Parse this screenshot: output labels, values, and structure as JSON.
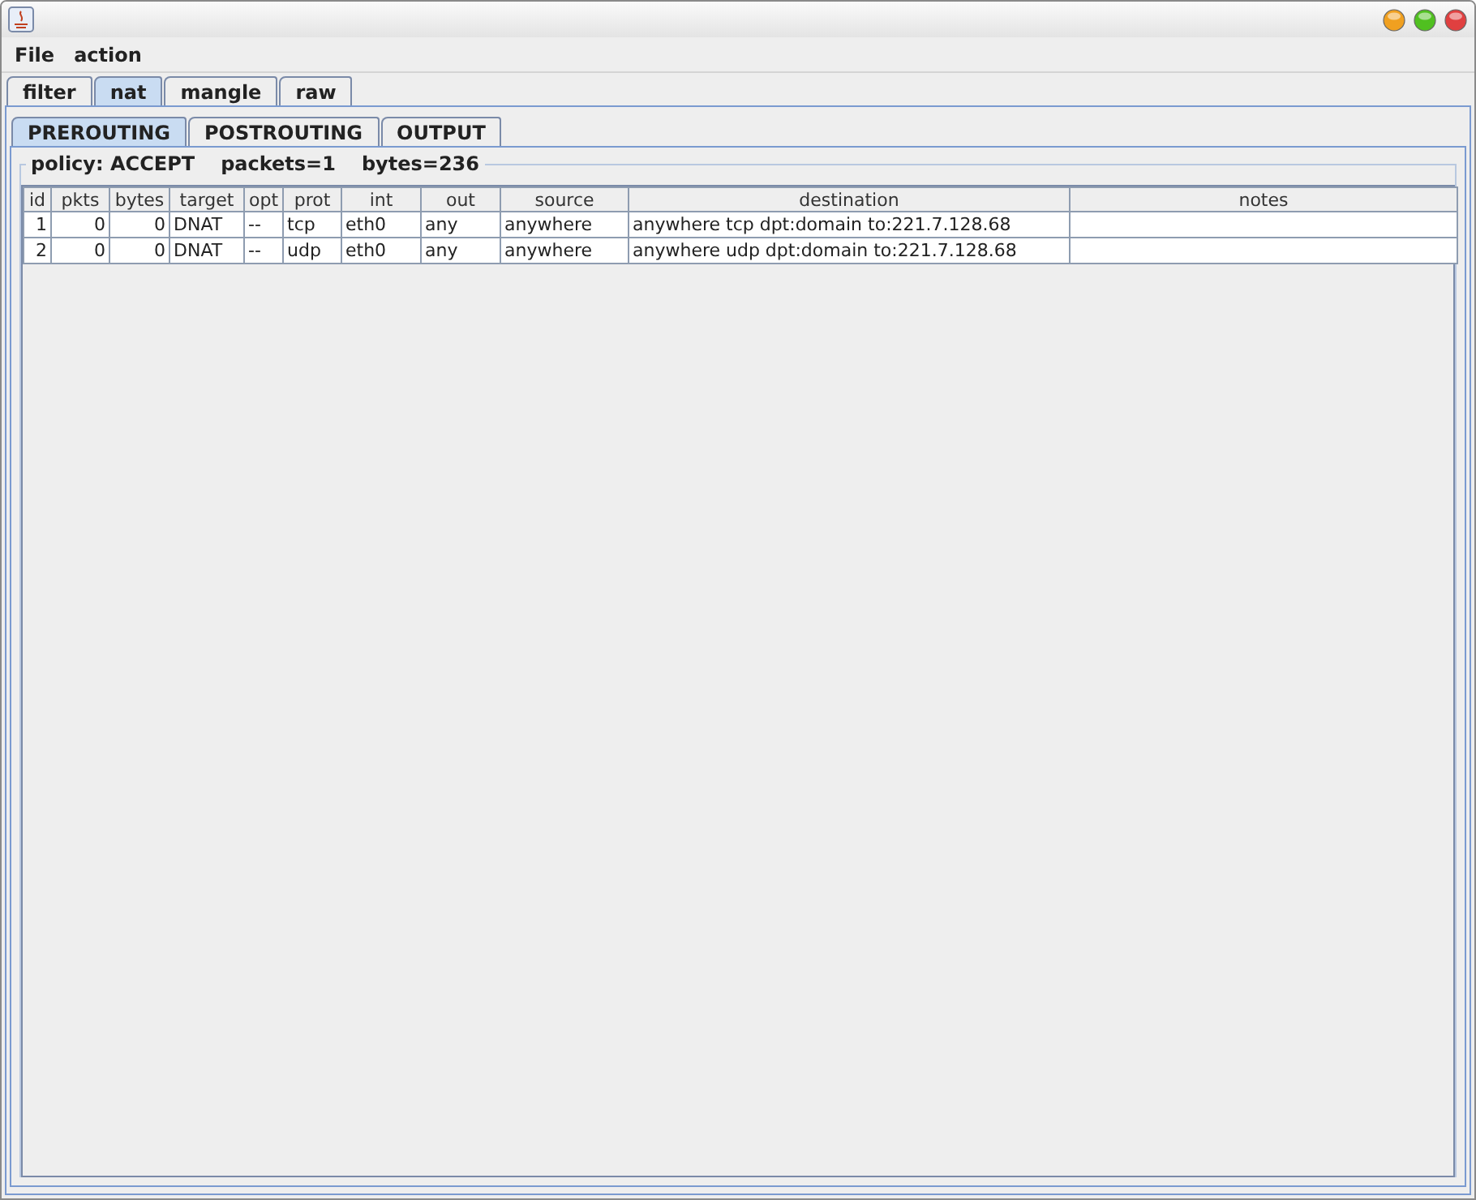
{
  "menu": [
    "File",
    "action"
  ],
  "tables_tabs": [
    {
      "label": "filter",
      "selected": false
    },
    {
      "label": "nat",
      "selected": true
    },
    {
      "label": "mangle",
      "selected": false
    },
    {
      "label": "raw",
      "selected": false
    }
  ],
  "chain_tabs": [
    {
      "label": "PREROUTING",
      "selected": true
    },
    {
      "label": "POSTROUTING",
      "selected": false
    },
    {
      "label": "OUTPUT",
      "selected": false
    }
  ],
  "policy": {
    "policy": "policy: ACCEPT",
    "packets": "packets=1",
    "bytes": "bytes=236"
  },
  "table": {
    "columns": [
      "id",
      "pkts",
      "bytes",
      "target",
      "opt",
      "prot",
      "int",
      "out",
      "source",
      "destination",
      "notes"
    ],
    "rows": [
      [
        "1",
        "0",
        "0",
        "DNAT",
        "--",
        "tcp",
        "eth0",
        "any",
        "anywhere",
        "anywhere tcp dpt:domain to:221.7.128.68",
        ""
      ],
      [
        "2",
        "0",
        "0",
        "DNAT",
        "--",
        "udp",
        "eth0",
        "any",
        "anywhere",
        "anywhere udp dpt:domain to:221.7.128.68",
        ""
      ]
    ]
  }
}
